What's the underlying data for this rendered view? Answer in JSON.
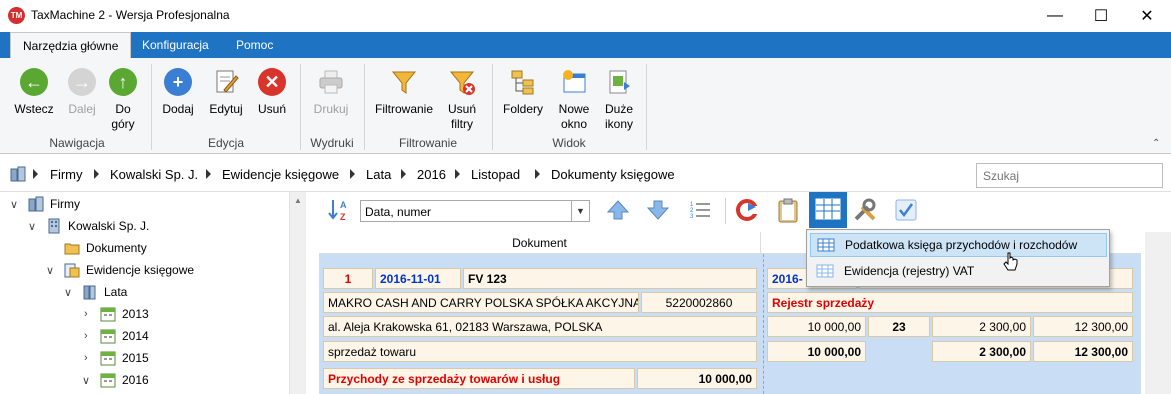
{
  "window": {
    "title": "TaxMachine 2 -  Wersja Profesjonalna",
    "app_badge": "TM",
    "controls": {
      "minimize": "—",
      "maximize": "☐",
      "close": "✕"
    }
  },
  "ribbon_tabs": [
    {
      "label": "Narzędzia główne",
      "active": true
    },
    {
      "label": "Konfiguracja",
      "active": false
    },
    {
      "label": "Pomoc",
      "active": false
    }
  ],
  "ribbon": {
    "groups": {
      "nawigacja": "Nawigacja",
      "edycja": "Edycja",
      "wydruki": "Wydruki",
      "filtrowanie": "Filtrowanie",
      "widok": "Widok"
    },
    "buttons": {
      "wstecz": "Wstecz",
      "dalej": "Dalej",
      "do_gory_1": "Do",
      "do_gory_2": "góry",
      "dodaj": "Dodaj",
      "edytuj": "Edytuj",
      "usun": "Usuń",
      "drukuj": "Drukuj",
      "filtrowanie": "Filtrowanie",
      "usun_filtry_1": "Usuń",
      "usun_filtry_2": "filtry",
      "foldery": "Foldery",
      "nowe_okno_1": "Nowe",
      "nowe_okno_2": "okno",
      "duze_ikony_1": "Duże",
      "duze_ikony_2": "ikony"
    }
  },
  "breadcrumb": [
    "Firmy",
    "Kowalski Sp. J.",
    "Ewidencje księgowe",
    "Lata",
    "2016",
    "Listopad",
    "Dokumenty księgowe"
  ],
  "search": {
    "placeholder": "Szukaj"
  },
  "tree": [
    {
      "label": "Firmy"
    },
    {
      "label": "Kowalski Sp. J."
    },
    {
      "label": "Dokumenty"
    },
    {
      "label": "Ewidencje księgowe"
    },
    {
      "label": "Lata"
    },
    {
      "label": "2013"
    },
    {
      "label": "2014"
    },
    {
      "label": "2015"
    },
    {
      "label": "2016"
    }
  ],
  "sort": {
    "value": "Data, numer"
  },
  "columns": {
    "document": "Dokument"
  },
  "record": {
    "lp": "1",
    "date": "2016-11-01",
    "number": "FV 123",
    "contractor": "MAKRO CASH AND CARRY POLSKA SPÓŁKA AKCYJNA",
    "nip": "5220002860",
    "address": "al. Aleja Krakowska 61, 02183 Warszawa, POLSKA",
    "description": "sprzedaż towaru",
    "category": "Przychody ze sprzedaży towarów i usług",
    "category_amount": "10 000,00",
    "vat_date": "2016-",
    "register": "Rejestr sprzedaży",
    "net": "10 000,00",
    "rate": "23",
    "vat": "2 300,00",
    "gross": "12 300,00",
    "sum_net": "10 000,00",
    "sum_vat": "2 300,00",
    "sum_gross": "12 300,00"
  },
  "dropdown_menu": [
    {
      "label": "Podatkowa księga przychodów i rozchodów",
      "highlighted": true
    },
    {
      "label": "Ewidencja (rejestry) VAT",
      "highlighted": false
    }
  ]
}
